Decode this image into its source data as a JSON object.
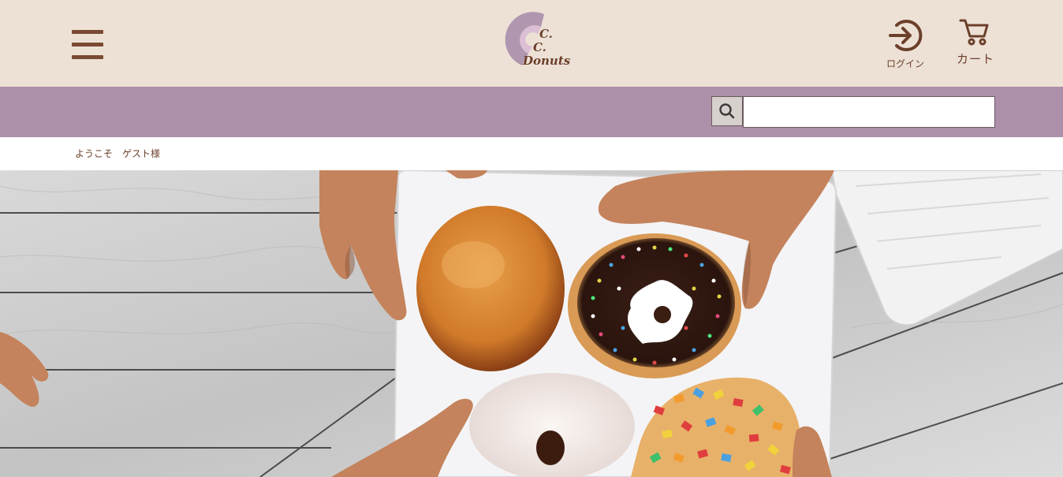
{
  "header": {
    "logo_text": "C.C.Donuts",
    "logo_line1": "C.",
    "logo_line2": "C.",
    "logo_line3": "Donuts",
    "login_label": "ログイン",
    "cart_label": "カート"
  },
  "search": {
    "placeholder": "",
    "value": ""
  },
  "welcome_text": "ようこそ　ゲスト様",
  "colors": {
    "header_bg": "#ede1d6",
    "band_bg": "#ad8fa9",
    "brand_brown": "#6b3f2a",
    "logo_lavender": "#b196b0",
    "logo_pink": "#dcbfd4"
  },
  "icons": {
    "menu": "hamburger-menu-icon",
    "login": "login-arrow-circle-icon",
    "cart": "cart-icon",
    "search": "search-icon"
  },
  "hero": {
    "alt": "donuts-on-plate-hero-image"
  }
}
